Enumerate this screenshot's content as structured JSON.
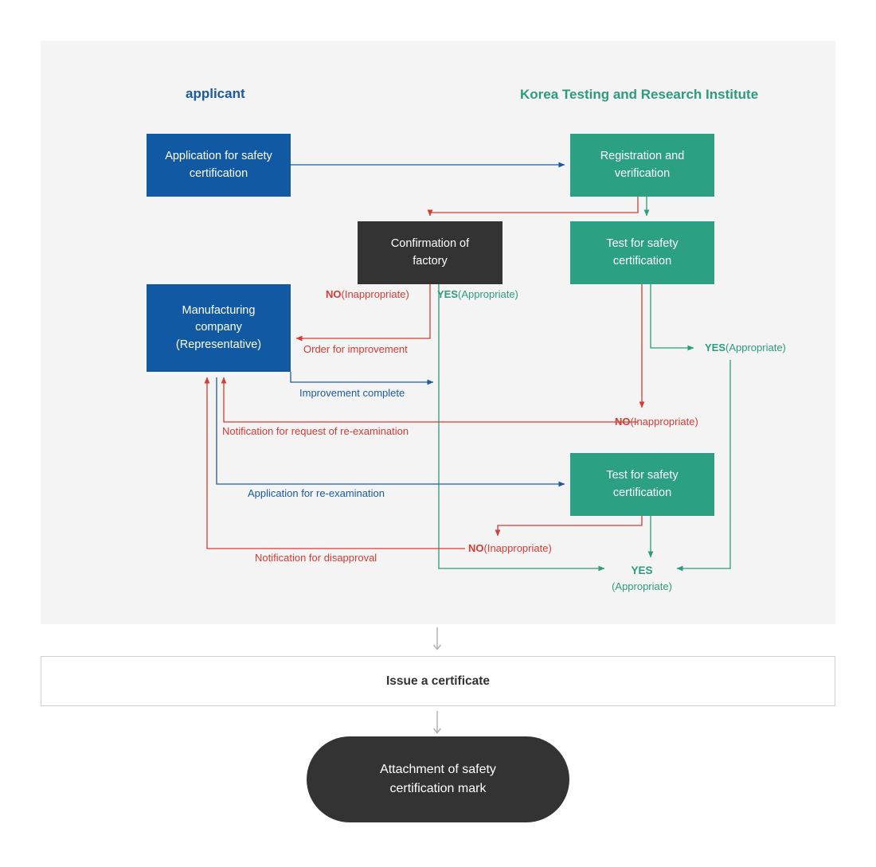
{
  "diagram": {
    "columns": {
      "applicant": "applicant",
      "institute": "Korea Testing and Research Institute"
    },
    "nodes": {
      "application": "Application for safety certification",
      "registration": "Registration and verification",
      "confirmation": "Confirmation of factory",
      "test1": "Test for safety certification",
      "manufacturing": "Manufacturing company (Representative)",
      "test2": "Test for safety certification"
    },
    "node_lines": {
      "application": [
        "Application for safety",
        "certification"
      ],
      "registration": [
        "Registration and",
        "verification"
      ],
      "confirmation": [
        "Confirmation of",
        "factory"
      ],
      "test1": [
        "Test for safety",
        "certification"
      ],
      "manufacturing": [
        "Manufacturing",
        "company",
        "(Representative)"
      ],
      "test2": [
        "Test for safety",
        "certification"
      ]
    },
    "edge_labels": {
      "no_factory_bold": "NO",
      "no_factory_rest": "(Inappropriate)",
      "yes_factory_bold": "YES",
      "yes_factory_rest": "(Appropriate)",
      "order_for_improvement": "Order for improvement",
      "improvement_complete": "Improvement complete",
      "notification_request_reexamination": "Notification for request of re-examination",
      "application_reexamination": "Application for re-examination",
      "yes_test1_bold": "YES",
      "yes_test1_rest": "(Appropriate)",
      "no_test1_bold": "NO",
      "no_test1_rest": "(Inappropriate)",
      "no_test2_bold": "NO",
      "no_test2_rest": "(Inappropriate)",
      "notification_disapproval": "Notification for disapproval",
      "yes_final_bold": "YES",
      "yes_final_rest": "(Appropriate)"
    },
    "outcome": {
      "certificate": "Issue a certificate",
      "attachment_lines": [
        "Attachment of safety",
        "certification mark"
      ],
      "attachment": "Attachment of safety certification mark"
    },
    "colors": {
      "blue": "#1259a4",
      "blue_text": "#1c5aa3",
      "green": "#2ba083",
      "green_text": "#2c9c7d",
      "red": "#d83a34",
      "dark": "#333333",
      "panel_bg": "#f4f4f4",
      "arrow_gray": "#b0b0b0"
    }
  }
}
